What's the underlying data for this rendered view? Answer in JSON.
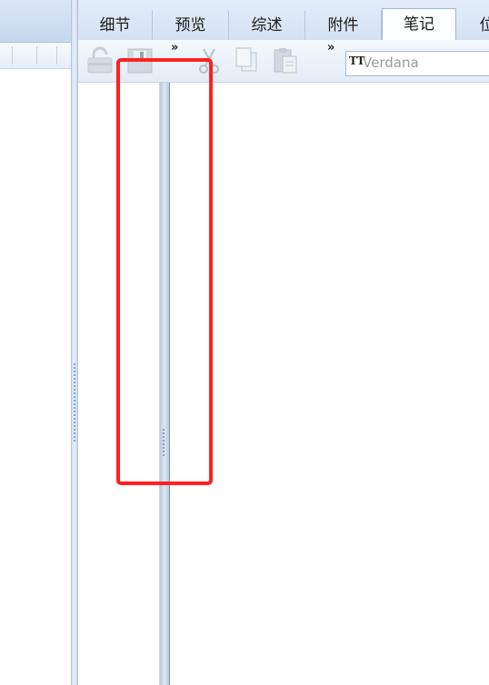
{
  "tabs": [
    {
      "label": "细节"
    },
    {
      "label": "预览"
    },
    {
      "label": "综述"
    },
    {
      "label": "附件"
    },
    {
      "label": "笔记"
    },
    {
      "label": "位"
    }
  ],
  "active_tab": "笔记",
  "toolbar": {
    "font_value": "Verdana",
    "font_icon": "TT",
    "overflow_glyph": "»",
    "icons": [
      "lock-icon",
      "save-icon",
      "cut-icon",
      "copy-icon",
      "paste-icon"
    ]
  },
  "colors": {
    "highlight": "#ff2020",
    "tab_background": "#d3e2f4",
    "splitter": "#c9d8ec"
  }
}
